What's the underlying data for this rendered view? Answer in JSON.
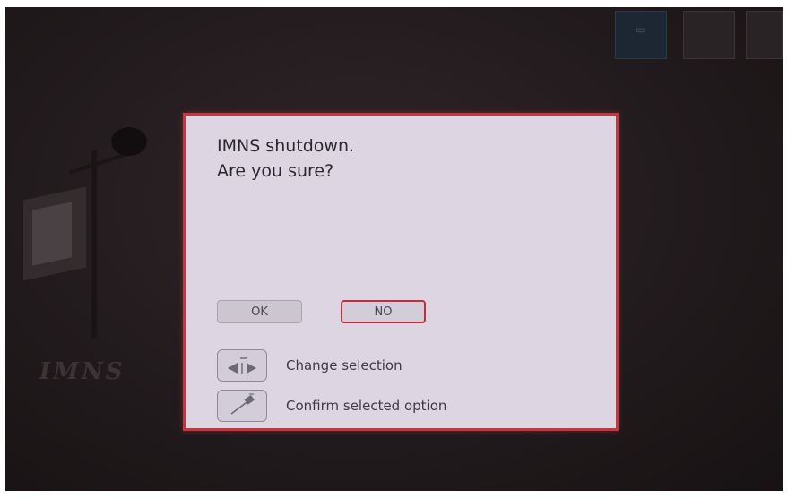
{
  "background": {
    "logo_text": "IMNS",
    "softkeys": [
      {
        "icon": "home-icon",
        "label": ""
      },
      {
        "icon": "",
        "label": ""
      },
      {
        "icon": "",
        "label": ""
      }
    ]
  },
  "dialog": {
    "message_line1": "IMNS shutdown.",
    "message_line2": "Are you sure?",
    "ok_label": "OK",
    "no_label": "NO",
    "selected": "NO",
    "hints": [
      {
        "icon": "left-right-arrows-icon",
        "text": "Change selection"
      },
      {
        "icon": "confirm-knob-icon",
        "text": "Confirm selected option"
      }
    ]
  },
  "colors": {
    "dialog_border": "#c8353f",
    "dialog_background": "#ddd6e2",
    "screen_background": "#221b1d"
  }
}
